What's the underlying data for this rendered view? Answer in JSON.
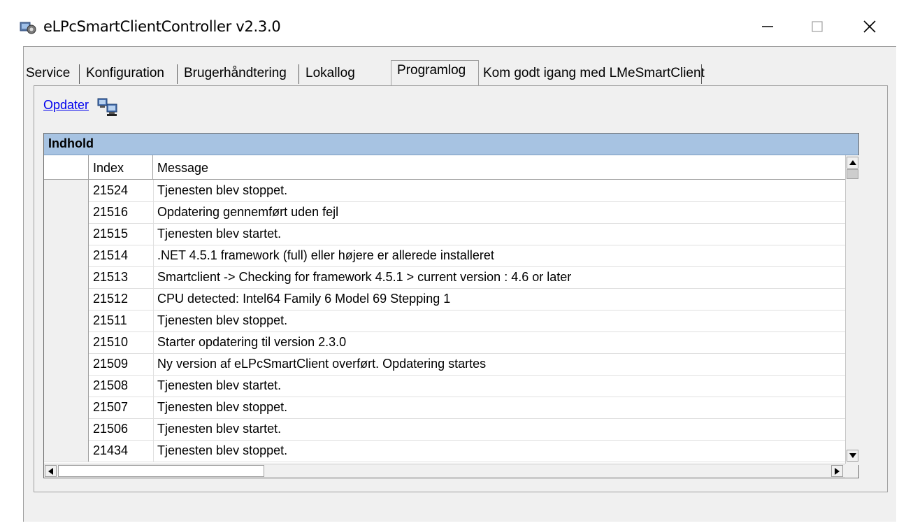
{
  "window": {
    "title": "eLPcSmartClientController v2.3.0",
    "icon": "gear-app-icon"
  },
  "tabs": [
    {
      "label": "Service"
    },
    {
      "label": "Konfiguration"
    },
    {
      "label": "Brugerhåndtering"
    },
    {
      "label": "Lokallog"
    },
    {
      "label": "Programlog",
      "active": true
    },
    {
      "label": "Kom godt igang med LMeSmartClient"
    }
  ],
  "toolbar": {
    "refresh_label": "Opdater",
    "refresh_icon": "computers-refresh-icon"
  },
  "grid": {
    "caption": "Indhold",
    "columns": [
      "Index",
      "Message"
    ],
    "rows": [
      {
        "index": "21524",
        "message": "Tjenesten blev stoppet."
      },
      {
        "index": "21516",
        "message": "Opdatering gennemført uden fejl"
      },
      {
        "index": "21515",
        "message": "Tjenesten blev startet."
      },
      {
        "index": "21514",
        "message": ".NET 4.5.1 framework (full) eller højere er allerede installeret"
      },
      {
        "index": "21513",
        "message": "Smartclient -> Checking for framework 4.5.1 > current version : 4.6 or later"
      },
      {
        "index": "21512",
        "message": "CPU detected: Intel64 Family 6 Model 69 Stepping 1"
      },
      {
        "index": "21511",
        "message": "Tjenesten blev stoppet."
      },
      {
        "index": "21510",
        "message": "Starter opdatering til version 2.3.0"
      },
      {
        "index": "21509",
        "message": "Ny version af eLPcSmartClient overført. Opdatering startes"
      },
      {
        "index": "21508",
        "message": "Tjenesten blev startet."
      },
      {
        "index": "21507",
        "message": "Tjenesten blev stoppet."
      },
      {
        "index": "21506",
        "message": "Tjenesten blev startet."
      },
      {
        "index": "21434",
        "message": "Tjenesten blev stoppet."
      }
    ]
  },
  "colors": {
    "caption_bg": "#a7c3e2",
    "link": "#0000ee",
    "panel_bg": "#f0f0f0"
  }
}
